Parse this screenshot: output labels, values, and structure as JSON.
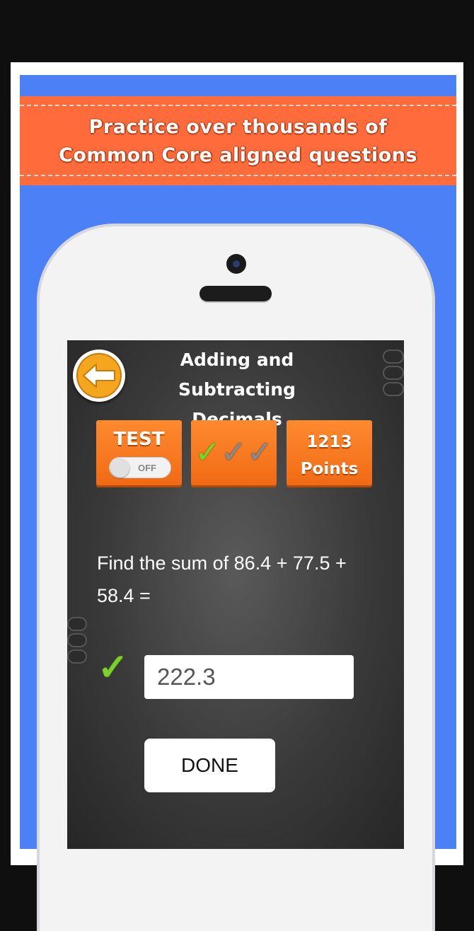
{
  "banner": {
    "line1": "Practice over thousands of",
    "line2": "Common Core aligned questions"
  },
  "header": {
    "title_line1": "Adding and Subtracting",
    "title_line2": "Decimals"
  },
  "test_panel": {
    "label": "TEST",
    "toggle_state": "OFF"
  },
  "progress": {
    "checks": [
      "correct",
      "unanswered",
      "unanswered"
    ],
    "check_glyph": "✓"
  },
  "points": {
    "value": "1213",
    "label": "Points"
  },
  "question": {
    "line1": "Find the sum of 86.4 + 77.5 +",
    "line2": "58.4 ="
  },
  "answer": {
    "value": "222.3",
    "status_glyph": "✓"
  },
  "done_button": {
    "label": "DONE"
  },
  "colors": {
    "banner": "#ff6b3a",
    "background": "#4b80f6",
    "accent_orange": "#f06a14",
    "correct_green": "#7bd12a"
  }
}
